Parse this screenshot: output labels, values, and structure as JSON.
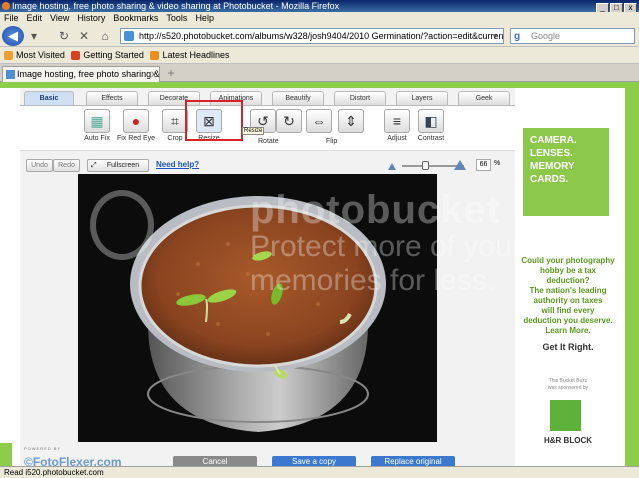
{
  "window": {
    "title": "Image hosting, free photo sharing & video sharing at Photobucket - Mozilla Firefox",
    "controls": [
      "_",
      "□",
      "x"
    ]
  },
  "menu": [
    "File",
    "Edit",
    "View",
    "History",
    "Bookmarks",
    "Tools",
    "Help"
  ],
  "nav": {
    "url": "http://s520.photobucket.com/albums/w328/josh9404/2010 Germination/?action=edit&current=TScor",
    "search_placeholder": "Google",
    "search_engine_glyph": "g"
  },
  "bookmarks": [
    {
      "label": "Most Visited",
      "color": "#f0a030"
    },
    {
      "label": "Getting Started",
      "color": "#d9401f"
    },
    {
      "label": "Latest Headlines",
      "color": "#f08c1a"
    }
  ],
  "tab": {
    "label": "Image hosting, free photo sharing & ...",
    "close": "x",
    "new": "+"
  },
  "editor": {
    "tabs": [
      "Basic",
      "Effects",
      "Decorate",
      "Animations",
      "Beautify",
      "Distort",
      "Layers",
      "Geek"
    ],
    "active_tab": "Basic",
    "tools": [
      {
        "label": "Auto Fix",
        "icon": "auto-fix-icon",
        "glyph": "▦"
      },
      {
        "label": "Fix Red Eye",
        "icon": "red-eye-icon",
        "glyph": "●"
      },
      {
        "label": "Crop",
        "icon": "crop-icon",
        "glyph": "⌗"
      },
      {
        "label": "Resize",
        "icon": "resize-icon",
        "glyph": "⊠"
      },
      {
        "label": "Rotate",
        "icon": "rotate-left-icon",
        "glyph": "↺"
      },
      {
        "label": "",
        "icon": "rotate-right-icon",
        "glyph": "↻"
      },
      {
        "label": "Flip",
        "icon": "flip-horizontal-icon",
        "glyph": "⇔"
      },
      {
        "label": "",
        "icon": "flip-vertical-icon",
        "glyph": "⇕"
      },
      {
        "label": "Adjust",
        "icon": "adjust-icon",
        "glyph": "≡"
      },
      {
        "label": "Contrast",
        "icon": "contrast-icon",
        "glyph": "◧"
      }
    ],
    "highlighted_tool": "Resize",
    "tooltip": "Resize",
    "controls": {
      "undo": "Undo",
      "redo": "Redo",
      "fullscreen": "Fullscreen",
      "help": "Need help?"
    },
    "zoom": {
      "value": "66",
      "unit": "%"
    },
    "bottom": {
      "powered_by": "POWERED BY",
      "brand": "©FotoFlexer.com",
      "cancel": "Cancel",
      "save_copy": "Save a copy",
      "replace": "Replace original"
    }
  },
  "watermark": {
    "line1": "photobucket",
    "line2": "Protect more of your memories for less."
  },
  "ads": {
    "banner": [
      "CAMERA.",
      "LENSES.",
      "MEMORY",
      "CARDS."
    ],
    "tax_lines": [
      "Could your photography",
      "hobby be a tax",
      "deduction?",
      "The nation's leading",
      "authority on taxes",
      "will find every",
      "deduction you deserve.",
      "Learn More."
    ],
    "cta": "Get It Right.",
    "sponsor_lines": [
      "This Bucket Buzz",
      "was sponsored by"
    ],
    "sponsor": "H&R BLOCK"
  },
  "status": "Read i520.photobucket.com",
  "colors": {
    "accent_green": "#8ccd4c",
    "highlight_red": "#d6232a",
    "link_blue": "#1a56c9",
    "button_blue": "#3b78d0",
    "button_gray": "#8a8a8a"
  }
}
